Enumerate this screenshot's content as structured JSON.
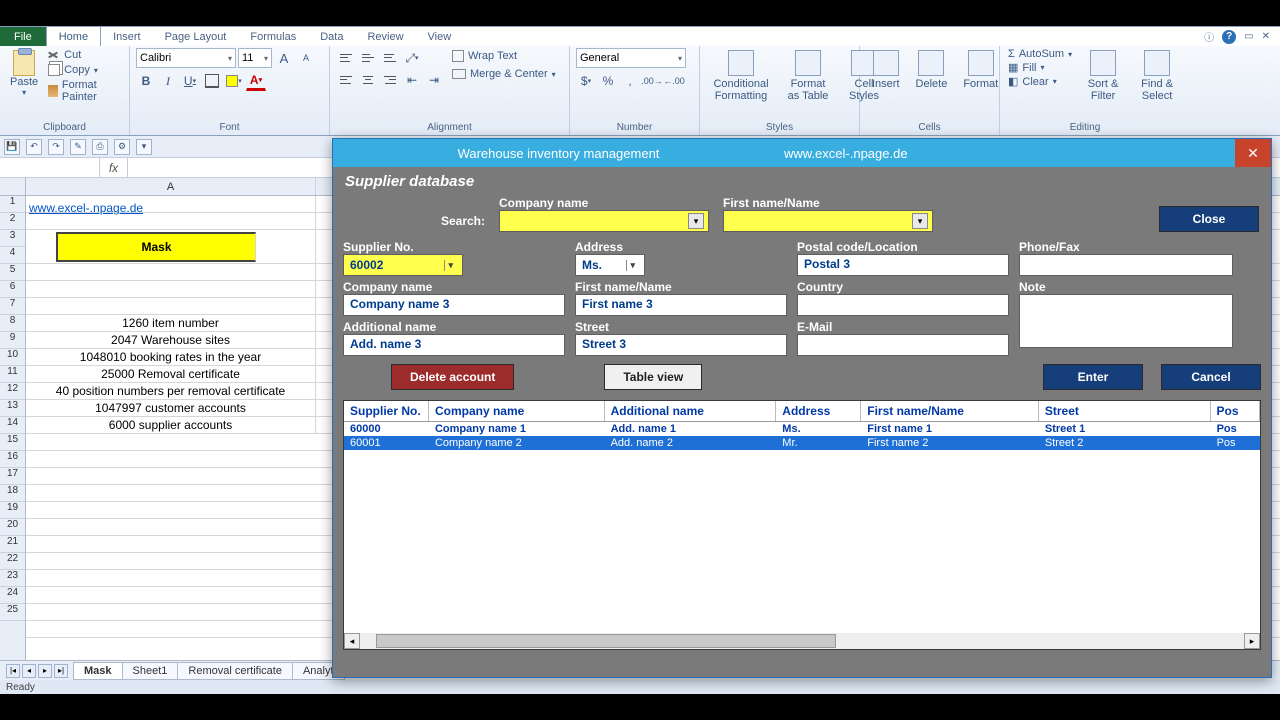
{
  "app": {
    "tabs": [
      "File",
      "Home",
      "Insert",
      "Page Layout",
      "Formulas",
      "Data",
      "Review",
      "View"
    ],
    "active_tab": "Home"
  },
  "ribbon": {
    "clipboard": {
      "label": "Clipboard",
      "paste": "Paste",
      "cut": "Cut",
      "copy": "Copy",
      "fp": "Format Painter"
    },
    "font": {
      "label": "Font",
      "name": "Calibri",
      "size": "11"
    },
    "alignment": {
      "label": "Alignment",
      "wrap": "Wrap Text",
      "merge": "Merge & Center"
    },
    "number": {
      "label": "Number",
      "format": "General"
    },
    "styles": {
      "label": "Styles",
      "cond": "Conditional Formatting",
      "table": "Format as Table",
      "cell": "Cell Styles"
    },
    "cells": {
      "label": "Cells",
      "insert": "Insert",
      "delete": "Delete",
      "format": "Format"
    },
    "editing": {
      "label": "Editing",
      "sum": "AutoSum",
      "fill": "Fill",
      "clear": "Clear",
      "sort": "Sort & Filter",
      "find": "Find & Select"
    }
  },
  "namebox": "",
  "sheet": {
    "link": "www.excel-.npage.de",
    "mask": "Mask",
    "lines": [
      "1260 item number",
      "2047 Warehouse sites",
      "1048010 booking rates in the year",
      "25000 Removal certificate",
      "40 position numbers per removal certificate",
      "1047997 customer accounts",
      "6000 supplier accounts"
    ],
    "tabs": [
      "Mask",
      "Sheet1",
      "Removal certificate",
      "Analyt"
    ]
  },
  "status": "Ready",
  "dialog": {
    "title": "Warehouse inventory management",
    "url": "www.excel-.npage.de",
    "banner": "Supplier database",
    "close": "Close",
    "search_label": "Search:",
    "search_company_label": "Company name",
    "search_firstname_label": "First name/Name",
    "labels": {
      "supplier_no": "Supplier No.",
      "company": "Company name",
      "additional": "Additional name",
      "address": "Address",
      "firstname": "First name/Name",
      "street": "Street",
      "postal": "Postal code/Location",
      "country": "Country",
      "email": "E-Mail",
      "phone": "Phone/Fax",
      "note": "Note"
    },
    "values": {
      "supplier_no": "60002",
      "company": "Company name 3",
      "additional": "Add. name 3",
      "address": "Ms.",
      "firstname": "First name 3",
      "street": "Street 3",
      "postal": "Postal 3",
      "country": "",
      "email": "",
      "phone": "",
      "note": ""
    },
    "buttons": {
      "delete": "Delete account",
      "tableview": "Table view",
      "enter": "Enter",
      "cancel": "Cancel"
    },
    "list": {
      "headers": [
        "Supplier No.",
        "Company name",
        "Additional name",
        "Address",
        "First name/Name",
        "Street",
        "Pos"
      ],
      "rows": [
        {
          "sup": "60000",
          "com": "Company name 1",
          "add": "Add. name 1",
          "adr": "Ms.",
          "fir": "First name 1",
          "str": "Street 1",
          "pos": "Pos"
        },
        {
          "sup": "60001",
          "com": "Company name 2",
          "add": "Add. name 2",
          "adr": "Mr.",
          "fir": "First name 2",
          "str": "Street 2",
          "pos": "Pos"
        }
      ],
      "selected_index": 1
    }
  }
}
